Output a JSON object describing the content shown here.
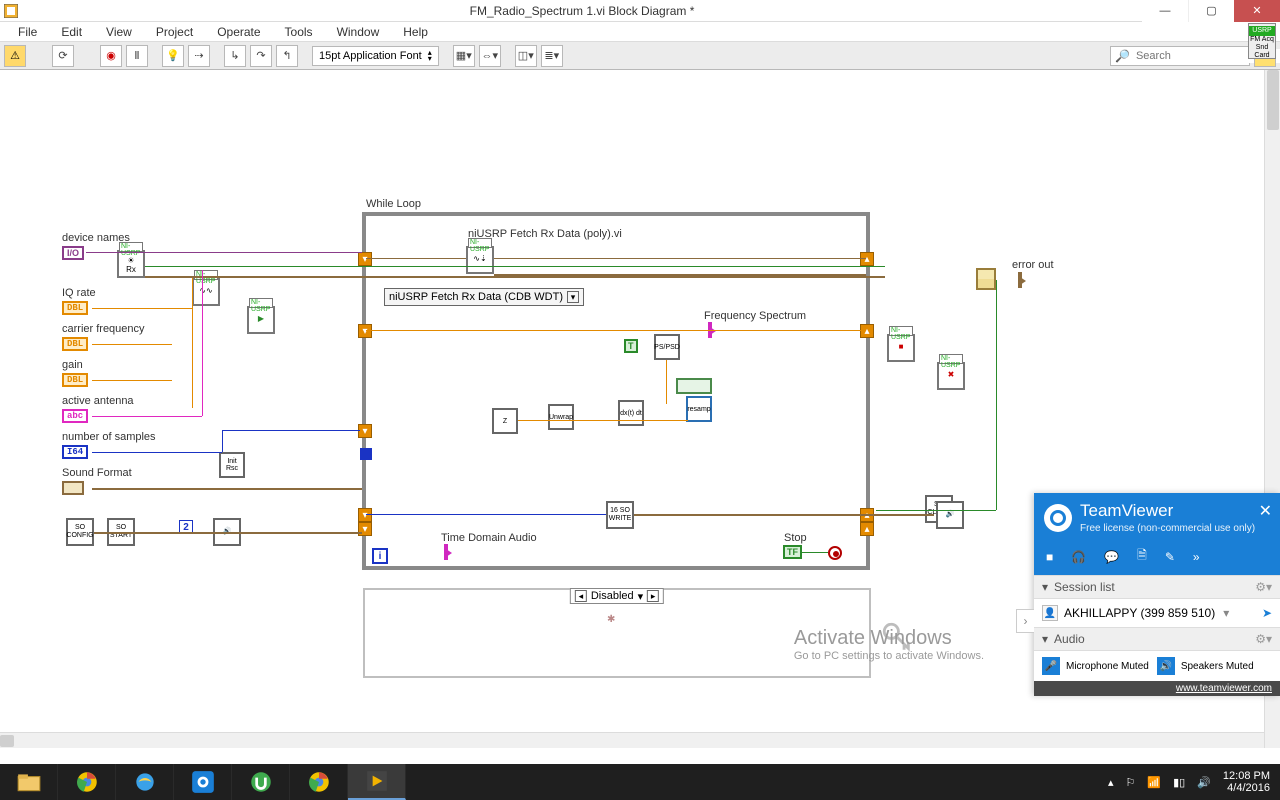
{
  "window": {
    "title": "FM_Radio_Spectrum 1.vi Block Diagram *"
  },
  "menu": {
    "file": "File",
    "edit": "Edit",
    "view": "View",
    "project": "Project",
    "operate": "Operate",
    "tools": "Tools",
    "window": "Window",
    "help": "Help"
  },
  "usrpBadge": {
    "top": "USRP",
    "line1": "FM Acq",
    "line2": "Snd Card"
  },
  "toolbar": {
    "font": "15pt Application Font",
    "searchPlaceholder": "Search"
  },
  "diagram": {
    "labels": {
      "device_names": "device names",
      "iq_rate": "IQ rate",
      "carrier_frequency": "carrier frequency",
      "gain": "gain",
      "active_antenna": "active antenna",
      "number_of_samples": "number of samples",
      "sound_format": "Sound Format",
      "while_loop": "While Loop",
      "fetch_vi": "niUSRP Fetch Rx Data (poly).vi",
      "freq_spectrum": "Frequency Spectrum",
      "time_domain_audio": "Time Domain Audio",
      "stop": "Stop",
      "error_out": "error out",
      "disabled": "Disabled"
    },
    "terminals": {
      "ivo": "I/O",
      "dbl": "DBL",
      "abc": "abc",
      "i64": "I64",
      "tf": "TF",
      "i": "i",
      "two": "2"
    },
    "poly_selector": "niUSRP Fetch Rx Data (CDB WDT)",
    "usrp_label": "NI-USRP",
    "node_text": {
      "init": "Init Rsc",
      "ps": "PS/PSD",
      "z": "Z",
      "unwrap": "Unwrap",
      "dxdt": "dx(t)\ndt",
      "resamp": "resamp",
      "so_config": "SO\nCONFIG",
      "so_start": "SO\nSTART",
      "so_write": "16 SO\nWRITE",
      "so_clear": "SO\nCLEAR"
    }
  },
  "watermark": {
    "title": "Activate Windows",
    "sub": "Go to PC settings to activate Windows."
  },
  "teamviewer": {
    "name": "TeamViewer",
    "sub": "Free license (non-commercial use only)",
    "session_list_h": "Session list",
    "session_name": "AKHILLAPPY (399 859 510)",
    "audio_h": "Audio",
    "mic": "Microphone Muted",
    "speakers": "Speakers Muted",
    "footer": "www.teamviewer.com"
  },
  "systray": {
    "time": "12:08 PM",
    "date": "4/4/2016"
  }
}
